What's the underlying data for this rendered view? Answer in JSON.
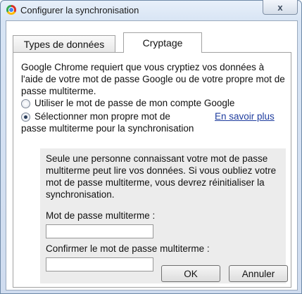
{
  "window": {
    "title": "Configurer la synchronisation",
    "close_glyph": "x"
  },
  "tabs": [
    {
      "label": "Types de données",
      "active": false
    },
    {
      "label": "Cryptage",
      "active": true
    }
  ],
  "intro": "Google Chrome requiert que vous cryptiez vos données à l'aide de votre mot de passe Google ou de votre propre mot de passe multiterme.",
  "options": [
    {
      "label": "Utiliser le mot de passe de mon compte Google",
      "selected": false
    },
    {
      "label_line1": "Sélectionner mon propre mot de",
      "label_line2": "passe multiterme pour la synchronisation",
      "selected": true
    }
  ],
  "learn_more": "En savoir plus",
  "info_box": {
    "text": "Seule une personne connaissant votre mot de passe multiterme peut lire vos données. Si vous oubliez votre mot de passe multiterme, vous devrez réinitialiser la synchronisation.",
    "passphrase_label": "Mot de passe multiterme :",
    "passphrase_value": "",
    "confirm_label": "Confirmer le mot de passe multiterme :",
    "confirm_value": ""
  },
  "buttons": {
    "ok": "OK",
    "cancel": "Annuler"
  },
  "colors": {
    "link": "#1e3c9e",
    "box_background": "#ececec"
  }
}
